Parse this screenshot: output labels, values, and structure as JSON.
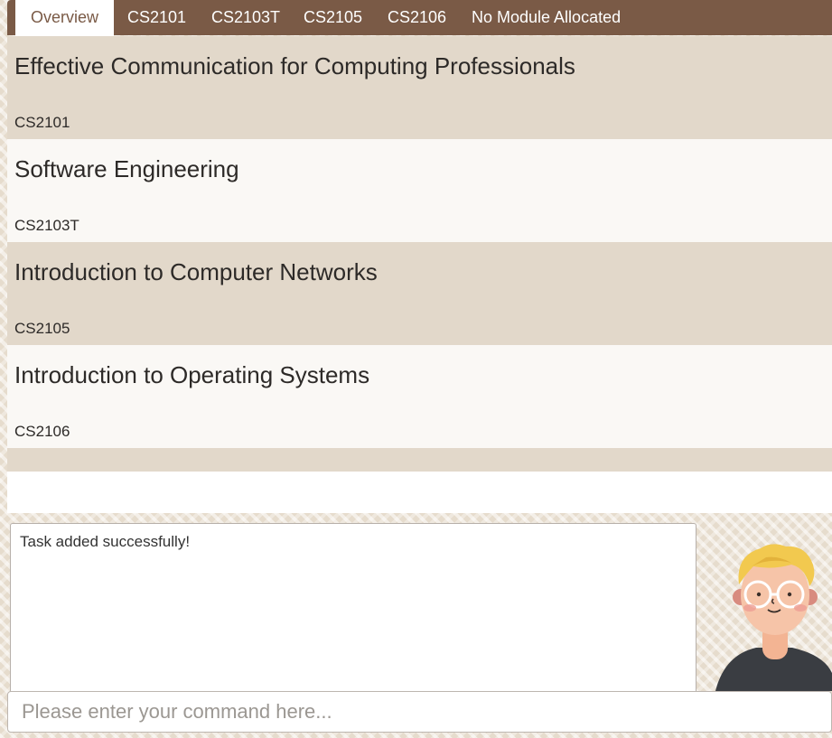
{
  "tabs": [
    {
      "label": "Overview",
      "active": true
    },
    {
      "label": "CS2101"
    },
    {
      "label": "CS2103T"
    },
    {
      "label": "CS2105"
    },
    {
      "label": "CS2106"
    },
    {
      "label": "No Module Allocated"
    }
  ],
  "modules": [
    {
      "title": "Effective Communication for Computing Professionals",
      "code": "CS2101"
    },
    {
      "title": "Software Engineering",
      "code": "CS2103T"
    },
    {
      "title": "Introduction to Computer Networks",
      "code": "CS2105"
    },
    {
      "title": "Introduction to Operating Systems",
      "code": "CS2106"
    }
  ],
  "result": {
    "message": "Task added successfully!"
  },
  "command": {
    "placeholder": "Please enter your command here...",
    "value": ""
  },
  "colors": {
    "tabbar": "#7a5a46",
    "card_odd": "#e2d8ca",
    "card_even": "#faf8f5"
  }
}
